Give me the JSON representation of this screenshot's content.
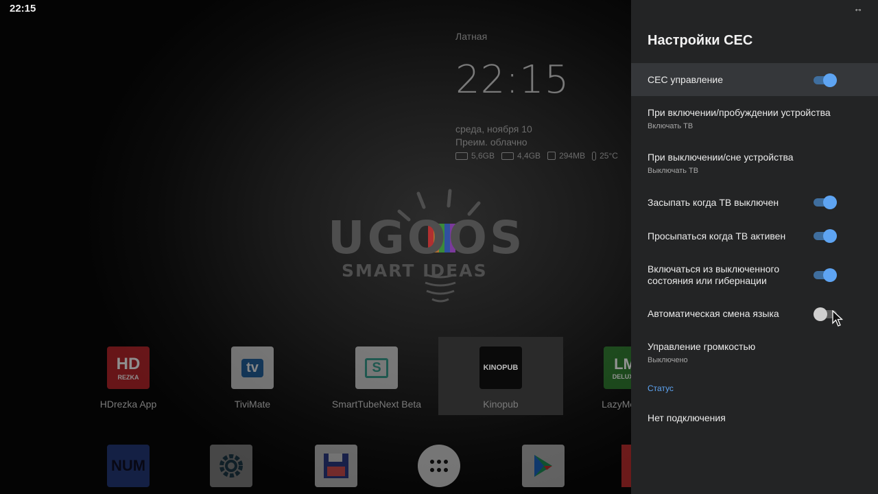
{
  "statusbar": {
    "time": "22:15"
  },
  "widget": {
    "location": "Латная",
    "clock": "22:15",
    "date": "среда, ноября 10",
    "condition": "Преим. облачно",
    "stats": [
      {
        "icon": "ram-icon",
        "value": "5,6GB"
      },
      {
        "icon": "storage-icon",
        "value": "4,4GB"
      },
      {
        "icon": "chip-icon",
        "value": "294MB"
      },
      {
        "icon": "thermometer-icon",
        "value": "25°C"
      }
    ]
  },
  "logo": {
    "brand": "UGOOS",
    "tagline": "SMART IDEAS"
  },
  "apps": [
    {
      "label": "HDrezka App",
      "icon_text": "HD",
      "icon_sub": "REZKA",
      "color": "#c0262b"
    },
    {
      "label": "TiviMate",
      "icon_text": "tv",
      "color": "#e6e6e6"
    },
    {
      "label": "SmartTubeNext Beta",
      "icon_text": "S",
      "color": "#e6e6e6"
    },
    {
      "label": "Kinopub",
      "icon_text": "KINOPUB",
      "color": "#0c0c0c"
    },
    {
      "label": "LazyMedia",
      "icon_text": "LM",
      "icon_sub": "DELUXE",
      "color": "#2e8b2e"
    }
  ],
  "dock": [
    {
      "name": "num-app-icon",
      "text": "NUM"
    },
    {
      "name": "settings-gear-icon"
    },
    {
      "name": "save-floppy-icon"
    },
    {
      "name": "all-apps-icon"
    },
    {
      "name": "play-store-icon"
    },
    {
      "name": "chrome-icon"
    }
  ],
  "panel": {
    "top_icon": "↔",
    "title": "Настройки CEC",
    "items": [
      {
        "title": "CEC управление",
        "toggle": true
      },
      {
        "title": "При включении/пробуждении устройства",
        "subtitle": "Включать ТВ"
      },
      {
        "title": "При выключении/сне устройства",
        "subtitle": "Выключать ТВ"
      },
      {
        "title": "Засыпать когда ТВ выключен",
        "toggle": true
      },
      {
        "title": "Просыпаться когда ТВ активен",
        "toggle": true
      },
      {
        "title_line1": "Включаться из выключенного",
        "title_line2": "состояния или гибернации",
        "toggle": true
      },
      {
        "title": "Автоматическая смена языка",
        "toggle": false
      },
      {
        "title": "Управление громкостью",
        "subtitle": "Выключено"
      }
    ],
    "section": "Статус",
    "status_text": "Нет подключения"
  },
  "colors": {
    "accent": "#5ea4f2",
    "panel_bg": "#232425"
  }
}
